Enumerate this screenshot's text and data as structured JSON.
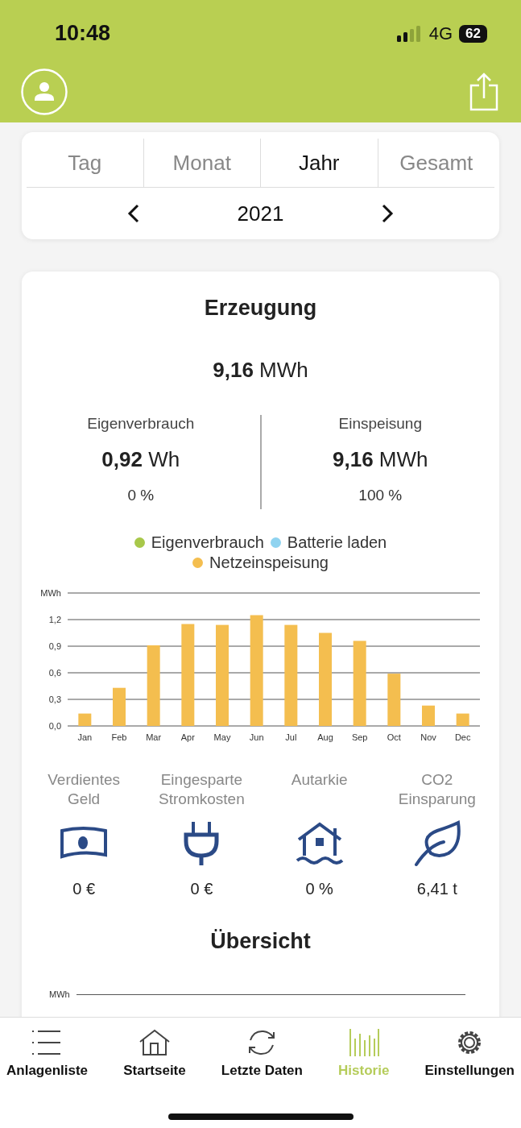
{
  "status_bar": {
    "time": "10:48",
    "network": "4G",
    "battery": "62"
  },
  "segments": [
    {
      "label": "Tag",
      "selected": false
    },
    {
      "label": "Monat",
      "selected": false
    },
    {
      "label": "Jahr",
      "selected": true
    },
    {
      "label": "Gesamt",
      "selected": false
    }
  ],
  "period": "2021",
  "production": {
    "title": "Erzeugung",
    "total_value": "9,16",
    "total_unit": "MWh",
    "split": [
      {
        "label": "Eigenverbrauch",
        "value": "0,92",
        "unit": "Wh",
        "share": "0 %"
      },
      {
        "label": "Einspeisung",
        "value": "9,16",
        "unit": "MWh",
        "share": "100 %"
      }
    ],
    "legend": [
      {
        "label": "Eigenverbrauch",
        "color": "#a8c84a"
      },
      {
        "label": "Batterie laden",
        "color": "#8fd3f0"
      }
    ],
    "chart_data": {
      "type": "bar",
      "grid": true,
      "categories": [
        "Jan",
        "Feb",
        "Mar",
        "Apr",
        "May",
        "Jun",
        "Jul",
        "Aug",
        "Sep",
        "Oct",
        "Nov",
        "Dec"
      ],
      "series": [
        {
          "name": "Netzeinspeisung",
          "color": "#f4be4f",
          "values": [
            0.14,
            0.43,
            0.91,
            1.15,
            1.14,
            1.25,
            1.14,
            1.05,
            0.96,
            0.59,
            0.23,
            0.14
          ]
        }
      ],
      "ylim": [
        0,
        1.5
      ],
      "yticks": [
        {
          "value": 0,
          "label": "0,0"
        },
        {
          "value": 0.3,
          "label": "0,3"
        },
        {
          "value": 0.6,
          "label": "0,6"
        },
        {
          "value": 0.9,
          "label": "0,9"
        },
        {
          "value": 1.2,
          "label": "1,2"
        },
        {
          "value": 1.5,
          "label": "MWh"
        }
      ]
    }
  },
  "savings": [
    {
      "kind": "money",
      "label": "Verdientes Geld",
      "value": "0 €"
    },
    {
      "kind": "plug",
      "label": "Eingesparte Stromkosten",
      "value": "0 €"
    },
    {
      "kind": "house",
      "label": "Autarkie",
      "value": "0 %"
    },
    {
      "kind": "leaf",
      "label": "CO2 Einsparung",
      "value": "6,41 t"
    }
  ],
  "overview": {
    "title": "Übersicht",
    "axis_unit": "MWh"
  },
  "tab_bar": [
    {
      "kind": "list",
      "label": "Anlagenliste",
      "selected": false
    },
    {
      "kind": "home",
      "label": "Startseite",
      "selected": false
    },
    {
      "kind": "refresh",
      "label": "Letzte Daten",
      "selected": false
    },
    {
      "kind": "history",
      "label": "Historie",
      "selected": true
    },
    {
      "kind": "settings",
      "label": "Einstellungen",
      "selected": false
    }
  ]
}
